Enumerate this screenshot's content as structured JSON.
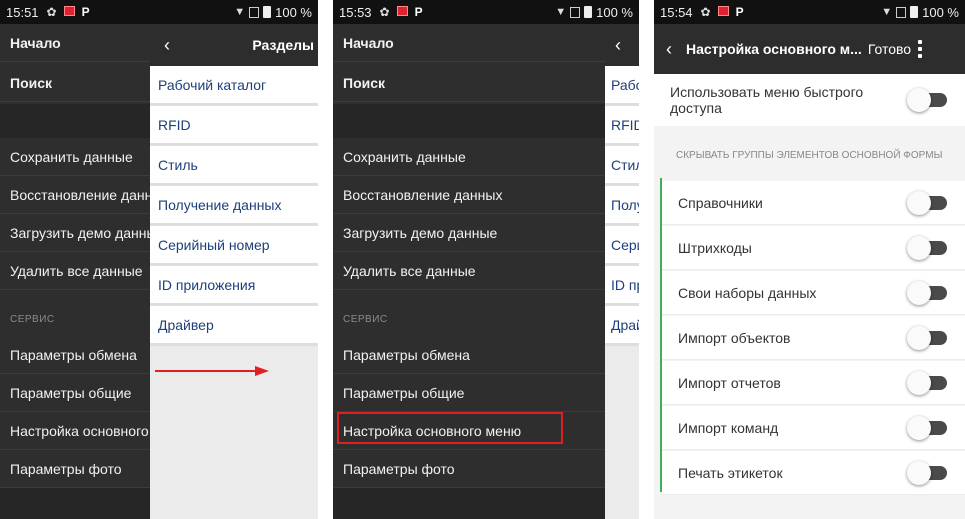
{
  "phone1": {
    "status": {
      "time": "15:51",
      "battery": "100 %"
    },
    "drawer": {
      "home": "Начало",
      "search": "Поиск",
      "items": [
        "Сохранить данные",
        "Восстановление данных",
        "Загрузить демо данные",
        "Удалить все данные"
      ],
      "service_section": "СЕРВИС",
      "service_items": [
        "Параметры обмена",
        "Параметры общие",
        "Настройка основного меню",
        "Параметры фото"
      ]
    },
    "submenu": {
      "title": "Разделы",
      "items": [
        "Рабочий каталог",
        "RFID",
        "Стиль",
        "Получение данных",
        "Серийный номер",
        "ID приложения",
        "Драйвер"
      ]
    }
  },
  "phone2": {
    "status": {
      "time": "15:53",
      "battery": "100 %"
    },
    "drawer": {
      "home": "Начало",
      "search": "Поиск",
      "items": [
        "Сохранить данные",
        "Восстановление данных",
        "Загрузить демо данные",
        "Удалить все данные"
      ],
      "service_section": "СЕРВИС",
      "service_items": [
        "Параметры обмена",
        "Параметры общие",
        "Настройка основного меню",
        "Параметры фото"
      ]
    },
    "submenu": {
      "items": [
        "Рабочий каталог",
        "RFID",
        "Стиль",
        "Получение данных",
        "Серийный номер",
        "ID приложения",
        "Драйвер"
      ]
    }
  },
  "phone3": {
    "status": {
      "time": "15:54",
      "battery": "100 %"
    },
    "header": {
      "title": "Настройка основного м...",
      "done": "Готово"
    },
    "quick_access": {
      "label": "Использовать меню быстрого доступа",
      "enabled": false
    },
    "group_title": "СКРЫВАТЬ ГРУППЫ ЭЛЕМЕНТОВ ОСНОВНОЙ ФОРМЫ",
    "toggles": [
      {
        "label": "Справочники",
        "enabled": false
      },
      {
        "label": "Штрихкоды",
        "enabled": false
      },
      {
        "label": "Свои наборы данных",
        "enabled": false
      },
      {
        "label": "Импорт объектов",
        "enabled": false
      },
      {
        "label": "Импорт отчетов",
        "enabled": false
      },
      {
        "label": "Импорт команд",
        "enabled": false
      },
      {
        "label": "Печать этикеток",
        "enabled": false
      }
    ]
  },
  "colors": {
    "highlight": "#e02020",
    "link_text": "#1e3f7a",
    "group_accent": "#3fae57"
  }
}
